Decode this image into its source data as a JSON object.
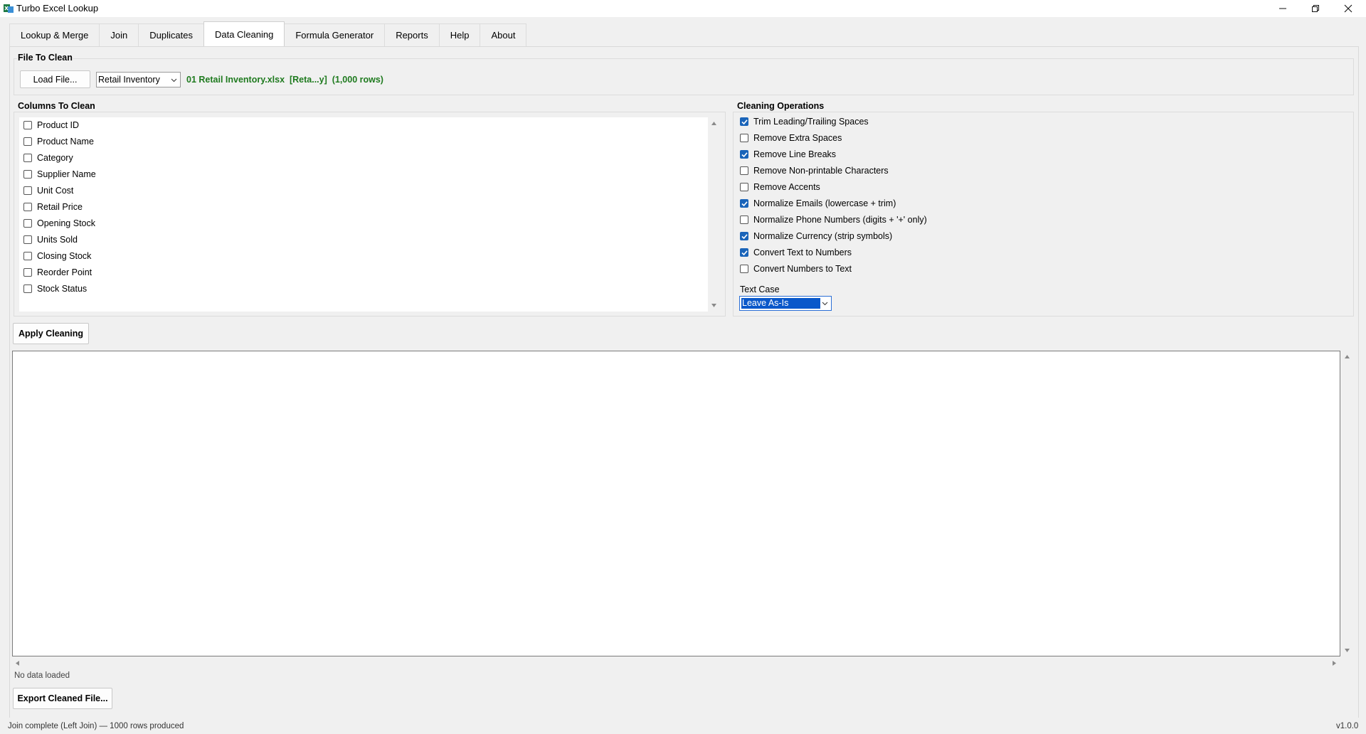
{
  "app": {
    "title": "Turbo Excel Lookup"
  },
  "tabs": [
    {
      "label": "Lookup & Merge",
      "active": false
    },
    {
      "label": "Join",
      "active": false
    },
    {
      "label": "Duplicates",
      "active": false
    },
    {
      "label": "Data Cleaning",
      "active": true
    },
    {
      "label": "Formula Generator",
      "active": false
    },
    {
      "label": "Reports",
      "active": false
    },
    {
      "label": "Help",
      "active": false
    },
    {
      "label": "About",
      "active": false
    }
  ],
  "file_section": {
    "title": "File To Clean",
    "load_button": "Load File...",
    "sheet_selected": "Retail Inventory",
    "file_info": "01 Retail Inventory.xlsx  [Reta...y]  (1,000 rows)"
  },
  "columns_section": {
    "title": "Columns To Clean",
    "items": [
      {
        "label": "Product ID",
        "checked": false
      },
      {
        "label": "Product Name",
        "checked": false
      },
      {
        "label": "Category",
        "checked": false
      },
      {
        "label": "Supplier Name",
        "checked": false
      },
      {
        "label": "Unit Cost",
        "checked": false
      },
      {
        "label": "Retail Price",
        "checked": false
      },
      {
        "label": "Opening Stock",
        "checked": false
      },
      {
        "label": "Units Sold",
        "checked": false
      },
      {
        "label": "Closing Stock",
        "checked": false
      },
      {
        "label": "Reorder Point",
        "checked": false
      },
      {
        "label": "Stock Status",
        "checked": false
      }
    ]
  },
  "operations_section": {
    "title": "Cleaning Operations",
    "items": [
      {
        "label": "Trim Leading/Trailing Spaces",
        "checked": true
      },
      {
        "label": "Remove Extra Spaces",
        "checked": false
      },
      {
        "label": "Remove Line Breaks",
        "checked": true
      },
      {
        "label": "Remove Non-printable Characters",
        "checked": false
      },
      {
        "label": "Remove Accents",
        "checked": false
      },
      {
        "label": "Normalize Emails (lowercase + trim)",
        "checked": true
      },
      {
        "label": "Normalize Phone Numbers (digits + '+' only)",
        "checked": false
      },
      {
        "label": "Normalize Currency (strip symbols)",
        "checked": true
      },
      {
        "label": "Convert Text to Numbers",
        "checked": true
      },
      {
        "label": "Convert Numbers to Text",
        "checked": false
      }
    ],
    "text_case_label": "Text Case",
    "text_case_value": "Leave As-Is"
  },
  "apply_button": "Apply Cleaning",
  "preview_status": "No data loaded",
  "export_button": "Export Cleaned File...",
  "status_bar": {
    "left": "Join complete (Left Join) — 1000 rows produced",
    "version": "v1.0.0"
  },
  "colors": {
    "accent": "#1a64b9",
    "file_info": "#1e7a1e",
    "selection": "#0a58ca"
  }
}
